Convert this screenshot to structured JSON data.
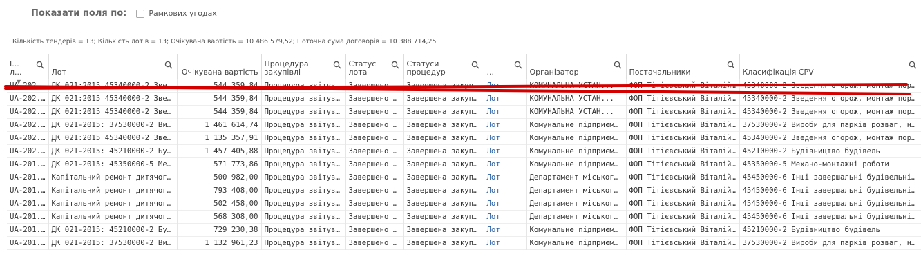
{
  "filter": {
    "show_fields_label": "Показати поля по:",
    "checkbox_label": "Рамкових угодах",
    "checked": false
  },
  "summary": "Кількість тендерів = 13; Кількість лотів = 13; Очікувана вартість = 10 486 579,52; Поточна сума договорів = 10 388 714,25",
  "table": {
    "columns": [
      "I... л...",
      "Лот",
      "Очікувана вартість",
      "Процедура закупівлі",
      "Статус лота",
      "Статуси процедур",
      "...",
      "Організатор",
      "Постачальники",
      "Класифікація CPV"
    ],
    "rows": [
      [
        "UA-202...",
        "ДК 021:2015 45340000-2 Зве...",
        "544 359,84",
        "Процедура звітува...",
        "Завершено ...",
        "Завершена закупі...",
        "Лот",
        "КОМУНАЛЬНА УСТАН...",
        "ФОП Тітієвський Віталій М...",
        "45340000-2 Зведення огорож, монтаж пор..."
      ],
      [
        "UA-202...",
        "ДК 021:2015 45340000-2 Зве...",
        "544 359,84",
        "Процедура звітува...",
        "Завершено ...",
        "Завершена закупі...",
        "Лот",
        "КОМУНАЛЬНА УСТАН...",
        "ФОП Тітієвський Віталій М...",
        "45340000-2 Зведення огорож, монтаж пор..."
      ],
      [
        "UA-202...",
        "ДК 021:2015 45340000-2 Зве...",
        "544 359,84",
        "Процедура звітува...",
        "Завершено ...",
        "Завершена закупі...",
        "Лот",
        "КОМУНАЛЬНА УСТАН...",
        "ФОП Тітієвський Віталій М...",
        "45340000-2 Зведення огорож, монтаж пор..."
      ],
      [
        "UA-202...",
        "ДК 021-2015: 37530000-2 Ви...",
        "1 461 614,74",
        "Процедура звітува...",
        "Завершено ...",
        "Завершена закупі...",
        "Лот",
        "Комунальне підприєм...",
        "ФОП Тітієвський Віталій М...",
        "37530000-2 Вироби для парків розваг, наст..."
      ],
      [
        "UA-202...",
        "ДК 021:2015 45340000-2 Зве...",
        "1 135 357,91",
        "Процедура звітува...",
        "Завершено ...",
        "Завершена закупі...",
        "Лот",
        "Комунальне підприєм...",
        "ФОП Тітієвський Віталій М...",
        "45340000-2 Зведення огорож, монтаж пор..."
      ],
      [
        "UA-202...",
        "ДК 021-2015: 45210000-2 Буд...",
        "1 457 405,88",
        "Процедура звітува...",
        "Завершено ...",
        "Завершена закупі...",
        "Лот",
        "Комунальне підприєм...",
        "ФОП Тітієвський Віталій М...",
        "45210000-2 Будівництво будівель"
      ],
      [
        "UA-201...",
        "ДК 021-2015: 45350000-5 Ме...",
        "571 773,86",
        "Процедура звітува...",
        "Завершено ...",
        "Завершена закупі...",
        "Лот",
        "Комунальне підприєм...",
        "ФОП Тітієвський Віталій М...",
        "45350000-5 Механо-монтажні роботи"
      ],
      [
        "UA-201...",
        "Капітальний ремонт дитячого ...",
        "500 982,00",
        "Процедура звітува...",
        "Завершено ...",
        "Завершена закупі...",
        "Лот",
        "Департамент міського ...",
        "ФОП Тітієвський Віталій М...",
        "45450000-6 Інші завершальні будівельні ро..."
      ],
      [
        "UA-201...",
        "Капітальний ремонт дитячого ...",
        "793 408,00",
        "Процедура звітува...",
        "Завершено ...",
        "Завершена закупі...",
        "Лот",
        "Департамент міського ...",
        "ФОП Тітієвський Віталій М...",
        "45450000-6 Інші завершальні будівельні ро..."
      ],
      [
        "UA-201...",
        "Капітальний ремонт дитячого ...",
        "502 458,00",
        "Процедура звітува...",
        "Завершено ...",
        "Завершена закупі...",
        "Лот",
        "Департамент міського ...",
        "ФОП Тітієвський Віталій М...",
        "45450000-6 Інші завершальні будівельні ро..."
      ],
      [
        "UA-201...",
        "Капітальний ремонт дитячого ...",
        "568 308,00",
        "Процедура звітува...",
        "Завершено ...",
        "Завершена закупі...",
        "Лот",
        "Департамент міського ...",
        "ФОП Тітієвський Віталій М...",
        "45450000-6 Інші завершальні будівельні ро..."
      ],
      [
        "UA-201...",
        "ДК 021-2015: 45210000-2 Буд...",
        "729 230,38",
        "Процедура звітува...",
        "Завершено ...",
        "Завершена закупі...",
        "Лот",
        "Комунальне підприєм...",
        "ФОП Тітієвський Віталій М...",
        "45210000-2 Будівництво будівель"
      ],
      [
        "UA-201...",
        "ДК 021-2015: 37530000-2 Ви...",
        "1 132 961,23",
        "Процедура звітува...",
        "Завершено ...",
        "Завершена закупі...",
        "Лот",
        "Комунальне підприєм...",
        "ФОП Тітієвський Віталій М...",
        "37530000-2 Вироби для парків розваг, наст..."
      ]
    ]
  },
  "colors": {
    "link": "#2a5fa3",
    "strike": "#d40000"
  }
}
